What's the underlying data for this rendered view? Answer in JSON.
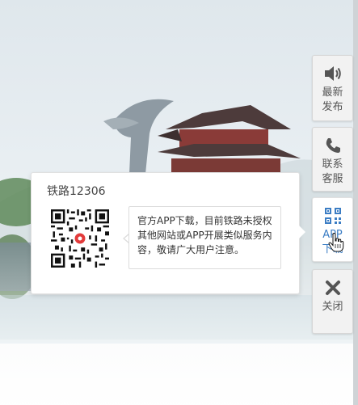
{
  "sidebar": {
    "items": [
      {
        "id": "news",
        "label": "最新发布",
        "icon": "speaker-icon"
      },
      {
        "id": "service",
        "label": "联系客服",
        "icon": "phone-icon"
      },
      {
        "id": "app",
        "label": "APP下载",
        "icon": "qr-code-icon"
      },
      {
        "id": "close",
        "label": "关闭",
        "icon": "close-icon"
      }
    ]
  },
  "popup": {
    "title": "铁路12306",
    "description": "官方APP下载，目前铁路未授权其他网站或APP开展类似服务内容，敬请广大用户注意。"
  },
  "colors": {
    "active_label": "#3b7dc4",
    "qr_center": "#e23b3b",
    "icon": "#555555"
  }
}
